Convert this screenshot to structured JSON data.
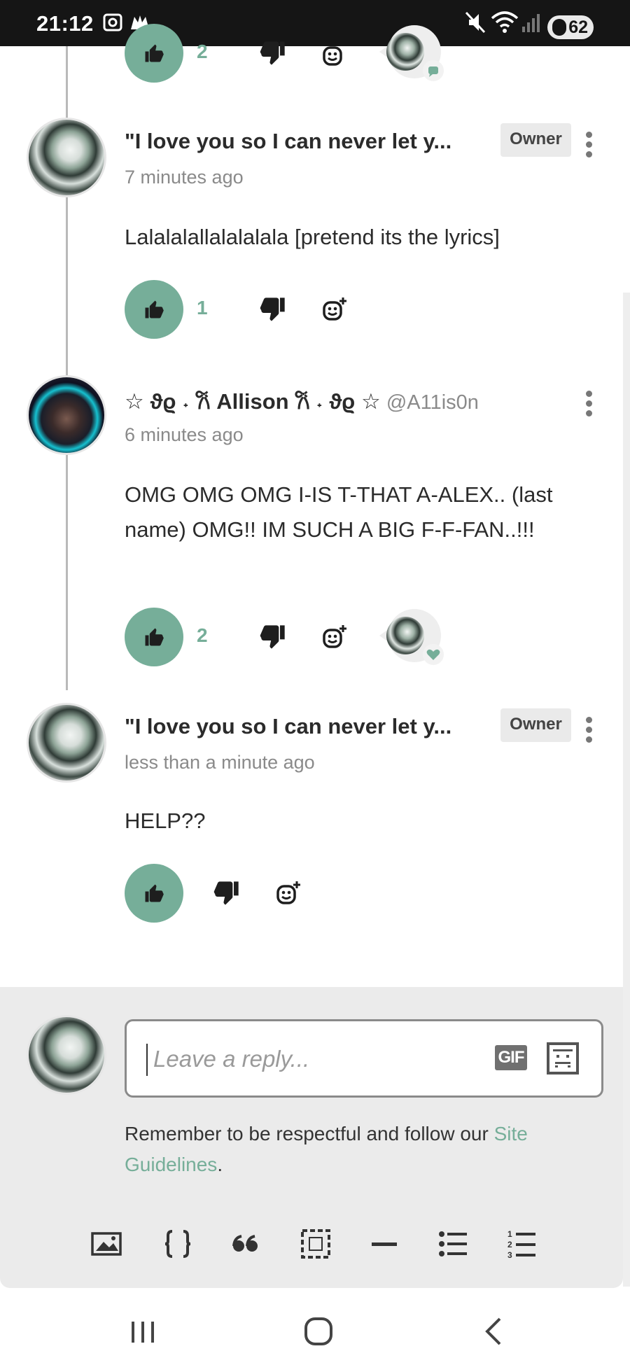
{
  "status_bar": {
    "time": "21:12",
    "battery": "62"
  },
  "top_partial": {
    "like_count": "2"
  },
  "comments": [
    {
      "author": "\"I love you so I can never let y...",
      "badge": "Owner",
      "time": "7 minutes ago",
      "body": "Lalalalallalalalala [pretend its the lyrics]",
      "like_count": "1"
    },
    {
      "author": "☆ ϑϱ ˖ 𐙚 Allison 𐙚 ˖ ϑϱ ☆",
      "handle": "@A11is0n",
      "time": "6 minutes ago",
      "body": "OMG OMG OMG I-IS T-THAT A-ALEX.. (last name) OMG!! IM SUCH A BIG F-F-FAN..!!!",
      "like_count": "2"
    },
    {
      "author": "\"I love you so I can never let y...",
      "badge": "Owner",
      "time": "less than a minute ago",
      "body": "HELP??"
    }
  ],
  "reply": {
    "placeholder": "Leave a reply...",
    "gif_label": "GIF",
    "guideline_text": "Remember to be respectful and follow our ",
    "guideline_link": "Site Guidelines",
    "guideline_end": "."
  },
  "toolbar": [
    "image-icon",
    "code-icon",
    "quote-icon",
    "spoiler-icon",
    "divider-icon",
    "bullet-list-icon",
    "numbered-list-icon"
  ],
  "colors": {
    "accent": "#76ae99",
    "status_bar": "#151515",
    "reply_bg": "#ebebeb"
  }
}
